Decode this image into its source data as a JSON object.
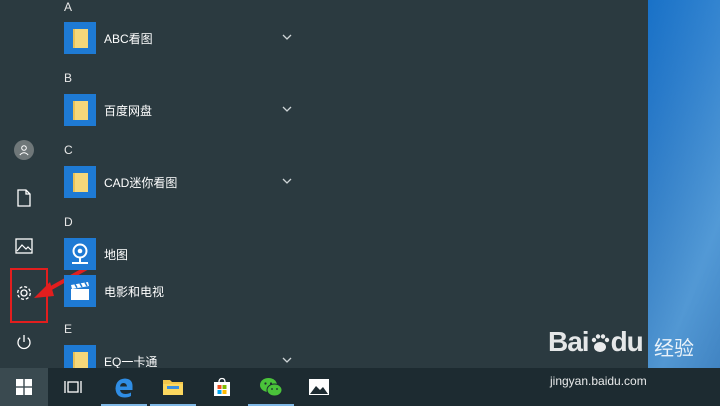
{
  "start_menu": {
    "sections": [
      {
        "letter": "A",
        "apps": [
          {
            "label": "ABC看图",
            "icon": "folder-icon",
            "expandable": true
          }
        ]
      },
      {
        "letter": "B",
        "apps": [
          {
            "label": "百度网盘",
            "icon": "folder-icon",
            "expandable": true
          }
        ]
      },
      {
        "letter": "C",
        "apps": [
          {
            "label": "CAD迷你看图",
            "icon": "folder-icon",
            "expandable": true
          }
        ]
      },
      {
        "letter": "D",
        "apps": [
          {
            "label": "地图",
            "icon": "maps-icon",
            "expandable": false
          },
          {
            "label": "电影和电视",
            "icon": "movies-tv-icon",
            "expandable": false
          }
        ]
      },
      {
        "letter": "E",
        "apps": [
          {
            "label": "EQ一卡通",
            "icon": "folder-icon",
            "expandable": true
          }
        ]
      }
    ],
    "rail": [
      "user-avatar-icon",
      "documents-icon",
      "pictures-icon",
      "settings-icon",
      "power-icon"
    ]
  },
  "taskbar": {
    "items": [
      "windows-start-icon",
      "task-view-icon",
      "edge-icon",
      "file-explorer-icon",
      "store-icon",
      "wechat-icon",
      "photos-icon"
    ]
  },
  "watermark": {
    "brand": "Bai",
    "brand_suffix": "du",
    "cn": "经验",
    "url": "jingyan.baidu.com"
  },
  "colors": {
    "menu_bg": "#2b3a40",
    "tile_blue": "#1e7ad4",
    "highlight": "#e21e1e",
    "taskbar_bg": "#1d2b31"
  }
}
